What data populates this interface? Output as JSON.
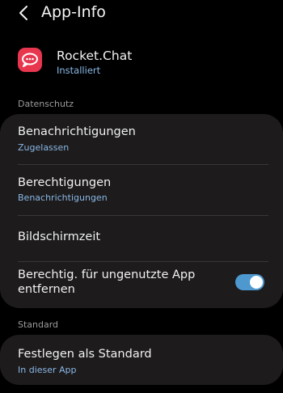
{
  "header": {
    "title": "App-Info",
    "back_icon": "chevron-left-icon"
  },
  "app": {
    "name": "Rocket.Chat",
    "status": "Installiert",
    "icon": "rocket-chat-logo-icon",
    "icon_color": "#e8364e"
  },
  "sections": {
    "privacy": {
      "label": "Datenschutz",
      "rows": {
        "notifications": {
          "title": "Benachrichtigungen",
          "subtitle": "Zugelassen"
        },
        "permissions": {
          "title": "Berechtigungen",
          "subtitle": "Benachrichtigungen"
        },
        "screen_time": {
          "title": "Bildschirmzeit"
        },
        "remove_permissions": {
          "title_line1": "Berechtig. für ungenutzte App",
          "title_line2": "entfernen",
          "toggle_on": true
        }
      }
    },
    "standard": {
      "label": "Standard",
      "rows": {
        "set_default": {
          "title": "Festlegen als Standard",
          "subtitle": "In dieser App"
        }
      }
    }
  },
  "colors": {
    "background": "#000000",
    "card": "#1d1b1c",
    "accent_text": "#8ab8e6",
    "toggle_on": "#4e98d0"
  }
}
